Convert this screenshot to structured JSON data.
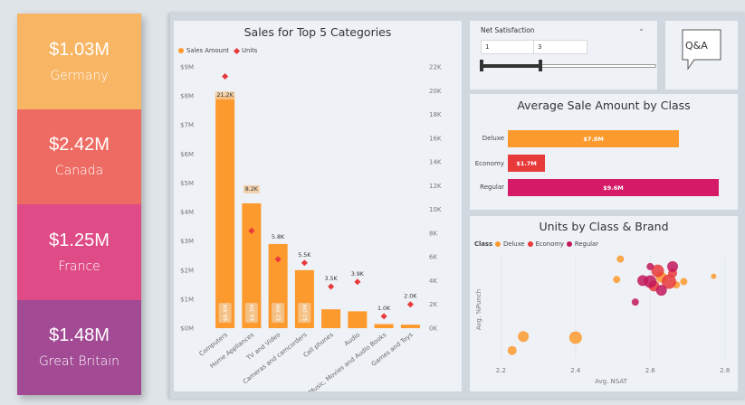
{
  "kpis": [
    {
      "value": "$1.03M",
      "label": "Germany",
      "color": "#f8b563"
    },
    {
      "value": "$2.42M",
      "label": "Canada",
      "color": "#ee6b63"
    },
    {
      "value": "$1.25M",
      "label": "France",
      "color": "#df4b86"
    },
    {
      "value": "$1.48M",
      "label": "Great Britain",
      "color": "#a24a93"
    }
  ],
  "sales": {
    "title": "Sales for Top 5 Categories",
    "legend": {
      "sales": "Sales Amount",
      "units": "Units"
    },
    "colors": {
      "bar": "#fd9a2e",
      "units": "#e8393b",
      "label_bg": "#f3c99a"
    }
  },
  "satisfaction": {
    "title": "Net Satisfaction",
    "min_value": "1",
    "max_value": "3",
    "range_fraction": [
      0,
      0.33
    ]
  },
  "qa": {
    "label": "Q&A"
  },
  "class_sales": {
    "title": "Average Sale Amount by Class",
    "colors": [
      "#fd9a2e",
      "#e8393b",
      "#d51b68"
    ]
  },
  "units_brand": {
    "title": "Units by Class & Brand",
    "legend_title": "Class",
    "legend": [
      "Deluxe",
      "Economy",
      "Regular"
    ],
    "colors": [
      "#fd9a2e",
      "#e8393b",
      "#c2185b"
    ],
    "xlabel": "Avg. NSAT",
    "ylabel": "Avg. %Punch",
    "xticks": [
      "2.2",
      "2.4",
      "2.6",
      "2.8"
    ]
  },
  "chart_data": [
    {
      "type": "bar",
      "title": "Sales for Top 5 Categories",
      "categories": [
        "Computers",
        "Home Appliances",
        "TV and Video",
        "Cameras and camcorders",
        "Cell phones",
        "Audio",
        "Music, Movies and Audio Books",
        "Games and Toys"
      ],
      "series": [
        {
          "name": "Sales Amount",
          "values": [
            8.0,
            4.3,
            2.9,
            2.0,
            0.65,
            0.58,
            0.14,
            0.12
          ],
          "bar_labels": [
            "$8.4M",
            "$4.3M",
            "$2.9M",
            "$2.0M",
            "",
            "",
            "",
            ""
          ]
        },
        {
          "name": "Units",
          "values": [
            21.2,
            8.2,
            5.8,
            5.5,
            3.5,
            3.9,
            1.0,
            2.0
          ],
          "point_labels": [
            "21.2K",
            "8.2K",
            "5.8K",
            "5.5K",
            "3.5K",
            "3.9K",
            "1.0K",
            "2.0K"
          ]
        }
      ],
      "y_left_ticks": [
        "$0M",
        "$1M",
        "$2M",
        "$3M",
        "$4M",
        "$5M",
        "$6M",
        "$7M",
        "$8M",
        "$9M"
      ],
      "y_right_ticks": [
        "0K",
        "2K",
        "4K",
        "6K",
        "8K",
        "10K",
        "12K",
        "14K",
        "16K",
        "18K",
        "20K",
        "22K"
      ],
      "ylim_left": [
        0,
        9
      ],
      "ylim_right": [
        0,
        22
      ],
      "legend_position": "top-left"
    },
    {
      "type": "bar",
      "title": "Average Sale Amount by Class",
      "categories": [
        "Deluxe",
        "Economy",
        "Regular"
      ],
      "values": [
        7.8,
        1.7,
        9.6
      ],
      "value_labels": [
        "$7.8M",
        "$1.7M",
        "$9.6M"
      ],
      "orientation": "horizontal"
    },
    {
      "type": "scatter",
      "title": "Units by Class & Brand",
      "xlabel": "Avg. NSAT",
      "ylabel": "Avg. %Punch",
      "xlim": [
        2.17,
        2.82
      ],
      "ylim": [
        0,
        1
      ],
      "points": [
        {
          "class": "Deluxe",
          "x": 2.26,
          "y": 0.25,
          "r": 6
        },
        {
          "class": "Deluxe",
          "x": 2.23,
          "y": 0.12,
          "r": 5
        },
        {
          "class": "Deluxe",
          "x": 2.4,
          "y": 0.24,
          "r": 7
        },
        {
          "class": "Deluxe",
          "x": 2.52,
          "y": 0.97,
          "r": 4
        },
        {
          "class": "Deluxe",
          "x": 2.51,
          "y": 0.78,
          "r": 4
        },
        {
          "class": "Deluxe",
          "x": 2.77,
          "y": 0.81,
          "r": 3
        },
        {
          "class": "Deluxe",
          "x": 2.63,
          "y": 0.8,
          "r": 6
        },
        {
          "class": "Deluxe",
          "x": 2.67,
          "y": 0.73,
          "r": 4
        },
        {
          "class": "Deluxe",
          "x": 2.69,
          "y": 0.76,
          "r": 4
        },
        {
          "class": "Economy",
          "x": 2.62,
          "y": 0.86,
          "r": 7
        },
        {
          "class": "Economy",
          "x": 2.65,
          "y": 0.76,
          "r": 8
        },
        {
          "class": "Economy",
          "x": 2.66,
          "y": 0.84,
          "r": 5
        },
        {
          "class": "Economy",
          "x": 2.61,
          "y": 0.72,
          "r": 6
        },
        {
          "class": "Regular",
          "x": 2.6,
          "y": 0.76,
          "r": 7
        },
        {
          "class": "Regular",
          "x": 2.63,
          "y": 0.68,
          "r": 6
        },
        {
          "class": "Regular",
          "x": 2.58,
          "y": 0.77,
          "r": 6
        },
        {
          "class": "Regular",
          "x": 2.6,
          "y": 0.9,
          "r": 4
        },
        {
          "class": "Regular",
          "x": 2.66,
          "y": 0.9,
          "r": 6
        },
        {
          "class": "Regular",
          "x": 2.56,
          "y": 0.57,
          "r": 4
        }
      ],
      "xticks": [
        2.2,
        2.4,
        2.6,
        2.8
      ],
      "legend_position": "top-left"
    }
  ]
}
